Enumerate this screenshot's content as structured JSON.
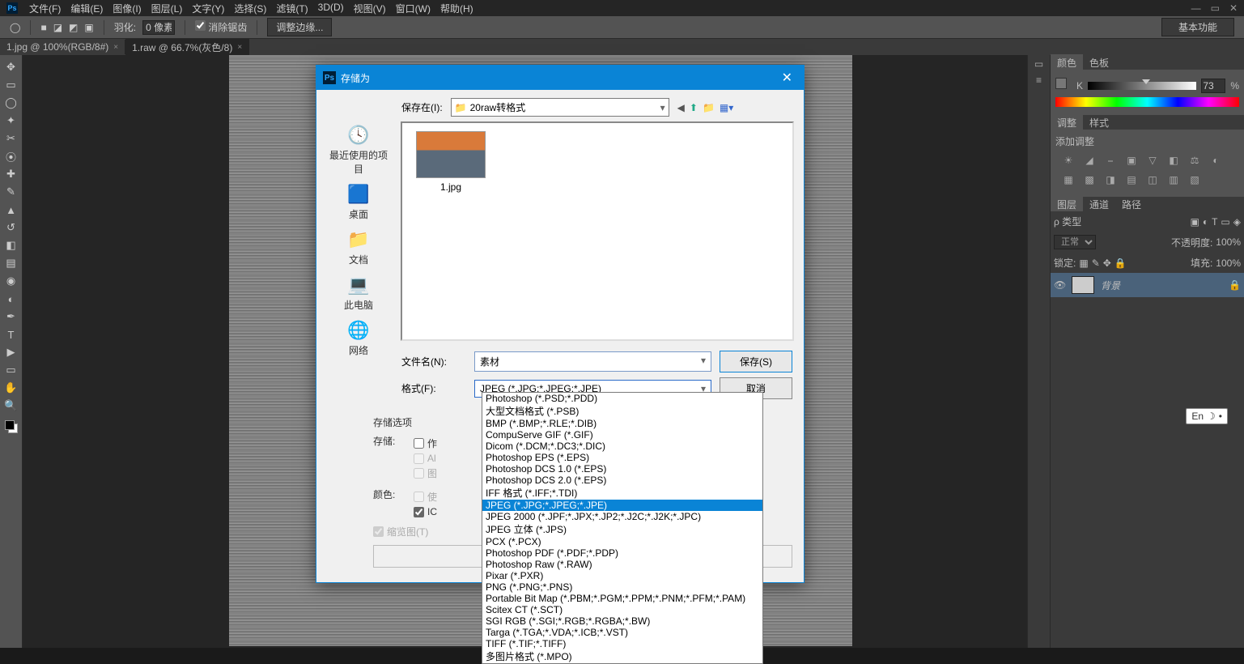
{
  "menu": [
    "文件(F)",
    "编辑(E)",
    "图像(I)",
    "图层(L)",
    "文字(Y)",
    "选择(S)",
    "滤镜(T)",
    "3D(D)",
    "视图(V)",
    "窗口(W)",
    "帮助(H)"
  ],
  "options": {
    "feather_label": "羽化:",
    "feather_value": "0 像素",
    "antialias": "消除锯齿",
    "adjust_edge": "调整边缘...",
    "workspace": "基本功能"
  },
  "tabs": [
    {
      "label": "1.jpg @ 100%(RGB/8#)",
      "active": false
    },
    {
      "label": "1.raw @ 66.7%(灰色/8)",
      "active": true
    }
  ],
  "right": {
    "color_tab": "颜色",
    "swatch_tab": "色板",
    "k_label": "K",
    "k_value": "73",
    "pct": "%",
    "adjust_tab": "调整",
    "style_tab": "样式",
    "add_adjust": "添加调整",
    "layers_tab": "图层",
    "channels_tab": "通道",
    "paths_tab": "路径",
    "kind": "ρ 类型",
    "blend": "正常",
    "opacity_lbl": "不透明度:",
    "opacity_val": "100%",
    "lock": "锁定:",
    "fill_lbl": "填充:",
    "fill_val": "100%",
    "layer_name": "背景"
  },
  "dialog": {
    "title": "存储为",
    "savein_lbl": "保存在(I):",
    "folder": "20raw转格式",
    "nav": [
      "最近使用的项目",
      "桌面",
      "文档",
      "此电脑",
      "网络"
    ],
    "file_name_thumb": "1.jpg",
    "filename_lbl": "文件名(N):",
    "filename_val": "素材",
    "format_lbl": "格式(F):",
    "format_val": "JPEG (*.JPG;*.JPEG;*.JPE)",
    "save_btn": "保存(S)",
    "cancel_btn": "取消",
    "opts_title": "存储选项",
    "store_lbl": "存储:",
    "as_copy": "作",
    "alpha": "Al",
    "layers_chk": "图",
    "color_lbl": "颜色:",
    "proof": "使",
    "icc": "IC",
    "thumb_chk": "缩览图(T)"
  },
  "formats": [
    "Photoshop (*.PSD;*.PDD)",
    "大型文档格式 (*.PSB)",
    "BMP (*.BMP;*.RLE;*.DIB)",
    "CompuServe GIF (*.GIF)",
    "Dicom (*.DCM;*.DC3;*.DIC)",
    "Photoshop EPS (*.EPS)",
    "Photoshop DCS 1.0 (*.EPS)",
    "Photoshop DCS 2.0 (*.EPS)",
    "IFF 格式 (*.IFF;*.TDI)",
    "JPEG (*.JPG;*.JPEG;*.JPE)",
    "JPEG 2000 (*.JPF;*.JPX;*.JP2;*.J2C;*.J2K;*.JPC)",
    "JPEG 立体 (*.JPS)",
    "PCX (*.PCX)",
    "Photoshop PDF (*.PDF;*.PDP)",
    "Photoshop Raw (*.RAW)",
    "Pixar (*.PXR)",
    "PNG (*.PNG;*.PNS)",
    "Portable Bit Map (*.PBM;*.PGM;*.PPM;*.PNM;*.PFM;*.PAM)",
    "Scitex CT (*.SCT)",
    "SGI RGB (*.SGI;*.RGB;*.RGBA;*.BW)",
    "Targa (*.TGA;*.VDA;*.ICB;*.VST)",
    "TIFF (*.TIF;*.TIFF)",
    "多图片格式 (*.MPO)"
  ],
  "formats_selected_index": 9,
  "ime": "En"
}
